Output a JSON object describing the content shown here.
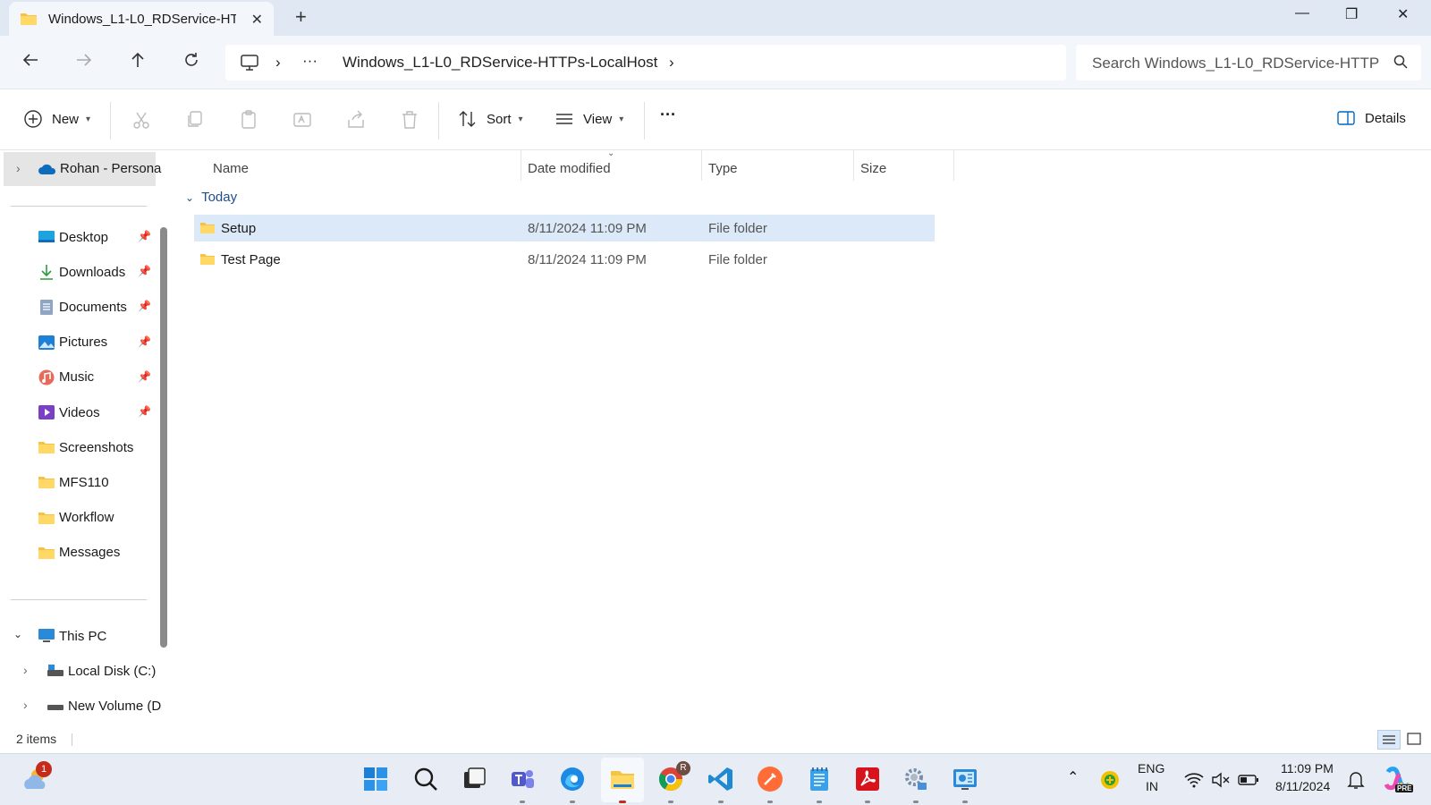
{
  "window": {
    "tab_title": "Windows_L1-L0_RDService-HT",
    "new_tab_symbol": "+",
    "minimize_symbol": "—",
    "restore_symbol": "❐",
    "close_symbol": "✕"
  },
  "address": {
    "overflow": "···",
    "folder": "Windows_L1-L0_RDService-HTTPs-LocalHost",
    "separator": "›"
  },
  "search": {
    "placeholder": "Search Windows_L1-L0_RDService-HTTP"
  },
  "toolbar": {
    "new_label": "New",
    "sort_label": "Sort",
    "view_label": "View",
    "more_label": "···",
    "details_label": "Details"
  },
  "nav": {
    "onedrive_label": "Rohan - Persona",
    "quick_access": [
      {
        "label": "Desktop",
        "icon": "desktop-icon",
        "pinned": true
      },
      {
        "label": "Downloads",
        "icon": "downloads-icon",
        "pinned": true
      },
      {
        "label": "Documents",
        "icon": "documents-icon",
        "pinned": true
      },
      {
        "label": "Pictures",
        "icon": "pictures-icon",
        "pinned": true
      },
      {
        "label": "Music",
        "icon": "music-icon",
        "pinned": true
      },
      {
        "label": "Videos",
        "icon": "videos-icon",
        "pinned": true
      },
      {
        "label": "Screenshots",
        "icon": "folder-icon",
        "pinned": false
      },
      {
        "label": "MFS110",
        "icon": "folder-icon",
        "pinned": false
      },
      {
        "label": "Workflow",
        "icon": "folder-icon",
        "pinned": false
      },
      {
        "label": "Messages",
        "icon": "folder-icon",
        "pinned": false
      }
    ],
    "this_pc_label": "This PC",
    "local_disk_label": "Local Disk (C:)",
    "new_volume_label": "New Volume (D"
  },
  "columns": {
    "name": "Name",
    "date": "Date modified",
    "type": "Type",
    "size": "Size"
  },
  "group_label": "Today",
  "files": [
    {
      "name": "Setup",
      "date": "8/11/2024 11:09 PM",
      "type": "File folder",
      "size": "",
      "selected": true
    },
    {
      "name": "Test Page",
      "date": "8/11/2024 11:09 PM",
      "type": "File folder",
      "size": "",
      "selected": false
    }
  ],
  "status": {
    "item_count": "2 items"
  },
  "taskbar": {
    "weather_badge": "1",
    "chrome_badge": "R",
    "lang_line1": "ENG",
    "lang_line2": "IN",
    "time": "11:09 PM",
    "date": "8/11/2024",
    "copilot_badge": "PRE"
  },
  "colors": {
    "accent": "#0067c0",
    "selection": "#dce9f8",
    "titlebar": "#dfe8f3",
    "folder": "#f5c342"
  }
}
